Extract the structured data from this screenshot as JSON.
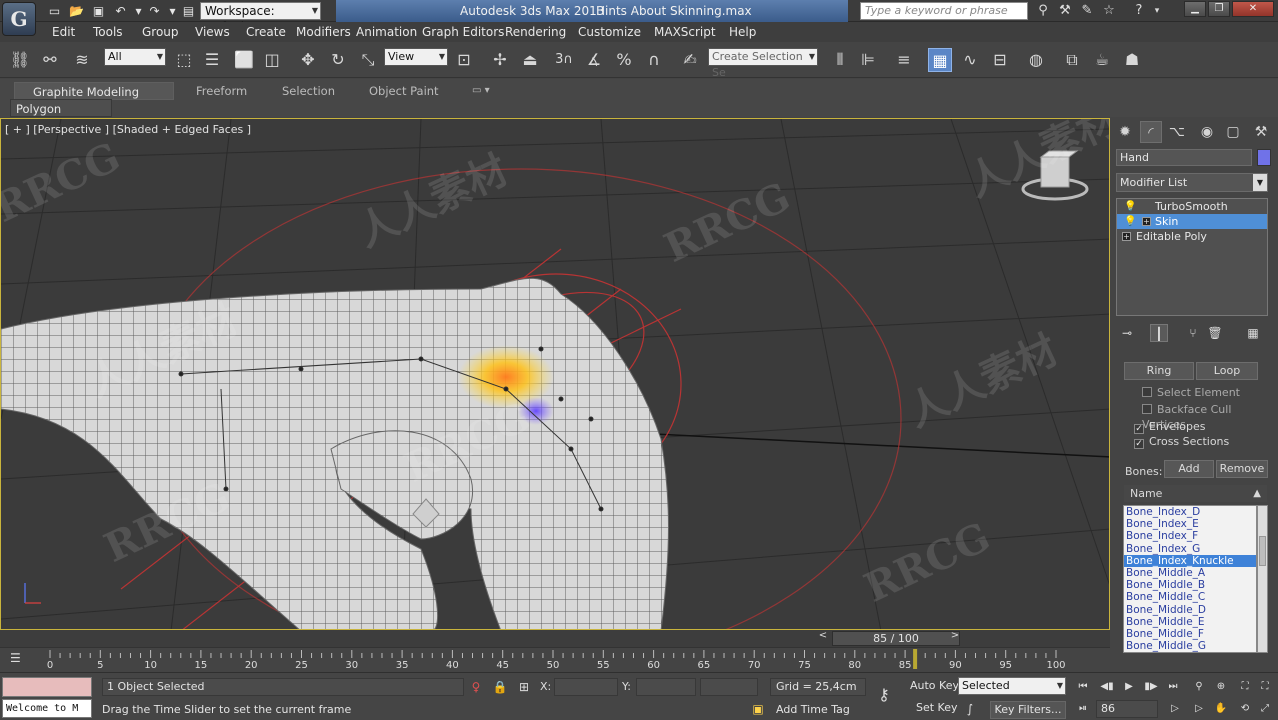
{
  "title_bar": {
    "app_title": "Autodesk 3ds Max  2013",
    "file_title": "Hints About Skinning.max",
    "workspace": "Workspace: Default",
    "search_placeholder": "Type a keyword or phrase",
    "logo_glyph": "G"
  },
  "menu": [
    "Edit",
    "Tools",
    "Group",
    "Views",
    "Create",
    "Modifiers",
    "Animation",
    "Graph Editors",
    "Rendering",
    "Customize",
    "MAXScript",
    "Help"
  ],
  "toolbar": {
    "selection_filter": "All",
    "ref_coord": "View",
    "snap_number": "3",
    "named_selection": "Create Selection Se"
  },
  "ribbon": {
    "tabs": [
      "Graphite Modeling Tools",
      "Freeform",
      "Selection",
      "Object Paint"
    ],
    "panel": "Polygon Modeling"
  },
  "viewport": {
    "label": "[ + ] [Perspective ] [Shaded + Edged Faces ]",
    "watermarks": [
      "RRCG",
      "人人素材",
      "RRCG",
      "人人素材",
      "RRCG",
      "人人素材",
      "RRCG",
      "人人素材",
      "RRCG",
      "人人素材",
      "RRCG",
      "人人素材"
    ]
  },
  "command_panel": {
    "object_name": "Hand",
    "object_color": "#7072e8",
    "modifier_list": "Modifier List",
    "stack": [
      {
        "label": "TurboSmooth",
        "selected": false
      },
      {
        "label": "Skin",
        "selected": true
      },
      {
        "label": "Editable Poly",
        "selected": false
      }
    ],
    "ring": "Ring",
    "loop": "Loop",
    "select_element": "Select Element",
    "backface_cull": "Backface Cull Vertices",
    "envelopes": "Envelopes",
    "cross_sections": "Cross Sections",
    "bones_label": "Bones:",
    "add": "Add",
    "remove": "Remove",
    "name_header": "Name",
    "bones": [
      "Bone_Index_D",
      "Bone_Index_E",
      "Bone_Index_F",
      "Bone_Index_G",
      "Bone_Index_Knuckle",
      "Bone_Middle_A",
      "Bone_Middle_B",
      "Bone_Middle_C",
      "Bone_Middle_D",
      "Bone_Middle_E",
      "Bone_Middle_F",
      "Bone_Middle_G"
    ],
    "selected_bone": "Bone_Index_Knuckle"
  },
  "timeline": {
    "frame_display": "85 / 100",
    "current_frame": 85,
    "total_frames": 100,
    "tick_labels": [
      "0",
      "5",
      "10",
      "15",
      "20",
      "25",
      "30",
      "35",
      "40",
      "45",
      "50",
      "55",
      "60",
      "65",
      "70",
      "75",
      "80",
      "85",
      "90",
      "95",
      "100"
    ]
  },
  "status": {
    "welcome": "Welcome to M",
    "selected": "1 Object Selected",
    "prompt": "Drag the Time Slider to set the current frame",
    "x_label": "X:",
    "y_label": "Y:",
    "grid": "Grid = 25,4cm",
    "add_time_tag": "Add Time Tag",
    "auto_key": "Auto Key",
    "set_key": "Set Key",
    "key_mode": "Selected",
    "key_filters": "Key Filters...",
    "frame_field": "86"
  },
  "colors": {
    "accent": "#5b86c6",
    "viewport_border": "#c9b43c",
    "selection_blue": "#4f8fd6",
    "bone_red": "#c23a3a"
  }
}
